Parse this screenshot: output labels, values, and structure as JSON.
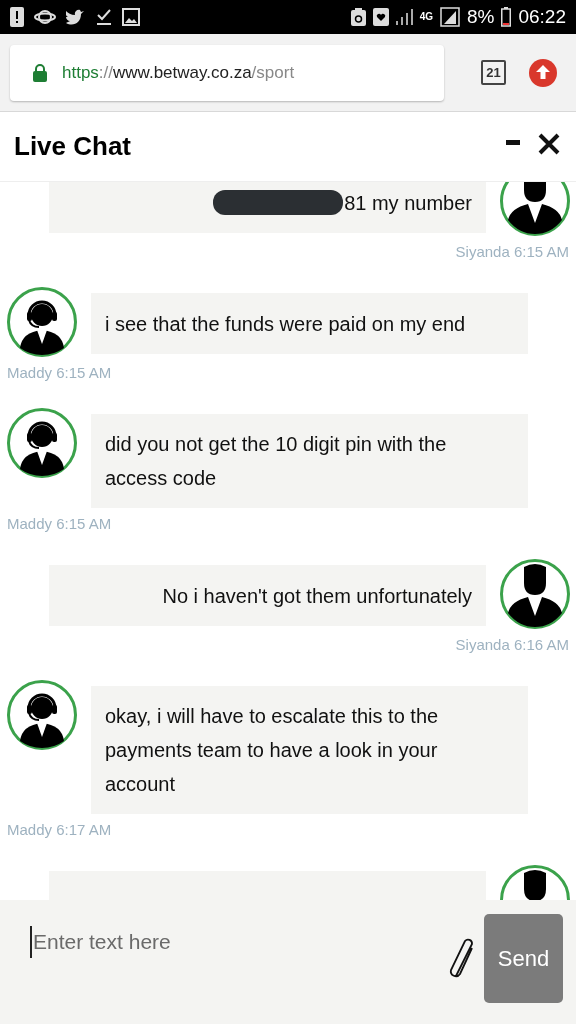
{
  "status_bar": {
    "network_type": "4G",
    "battery": "8%",
    "time": "06:22"
  },
  "browser": {
    "url": {
      "scheme": "https",
      "separator": "://",
      "host": "www.betway.co.za",
      "path": "/sport"
    },
    "tab_count": "21"
  },
  "chat": {
    "title": "Live Chat",
    "messages": [
      {
        "kind": "right",
        "text": "81 my number",
        "redacted": true,
        "meta": "Siyanda 6:15 AM"
      },
      {
        "kind": "left",
        "text": "i see that the funds were paid on my end",
        "meta": "Maddy 6:15 AM"
      },
      {
        "kind": "left",
        "text": "did you not get the 10 digit pin with the access code",
        "meta": "Maddy 6:15 AM"
      },
      {
        "kind": "right",
        "text": "No i haven't got them unfortunately",
        "meta": "Siyanda 6:16 AM"
      },
      {
        "kind": "left",
        "text": "okay, i will have to escalate this to the payments team to have a look in your account",
        "meta": "Maddy 6:17 AM"
      },
      {
        "kind": "right"
      }
    ]
  },
  "composer": {
    "placeholder": "Enter text here",
    "send_label": "Send"
  }
}
